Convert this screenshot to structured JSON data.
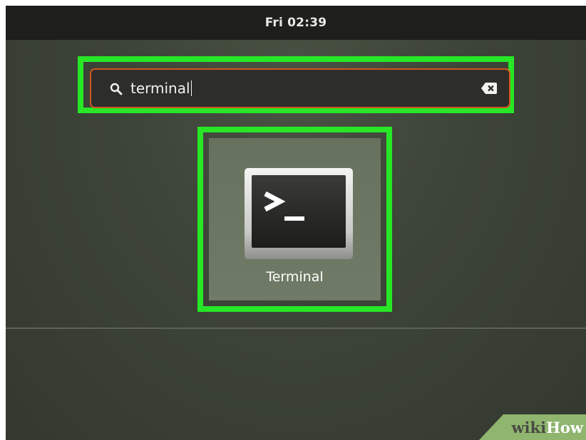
{
  "top_bar": {
    "clock": "Fri 02:39"
  },
  "search": {
    "query": "terminal",
    "search_icon": "search-icon",
    "clear_icon": "clear-text-icon",
    "border_color": "#d0561f"
  },
  "results": [
    {
      "label": "Terminal",
      "icon": "terminal-app-icon",
      "prompt_glyph": ">_"
    }
  ],
  "highlight_color": "#27e727",
  "watermark": {
    "wiki": "wiki",
    "how": "How"
  }
}
